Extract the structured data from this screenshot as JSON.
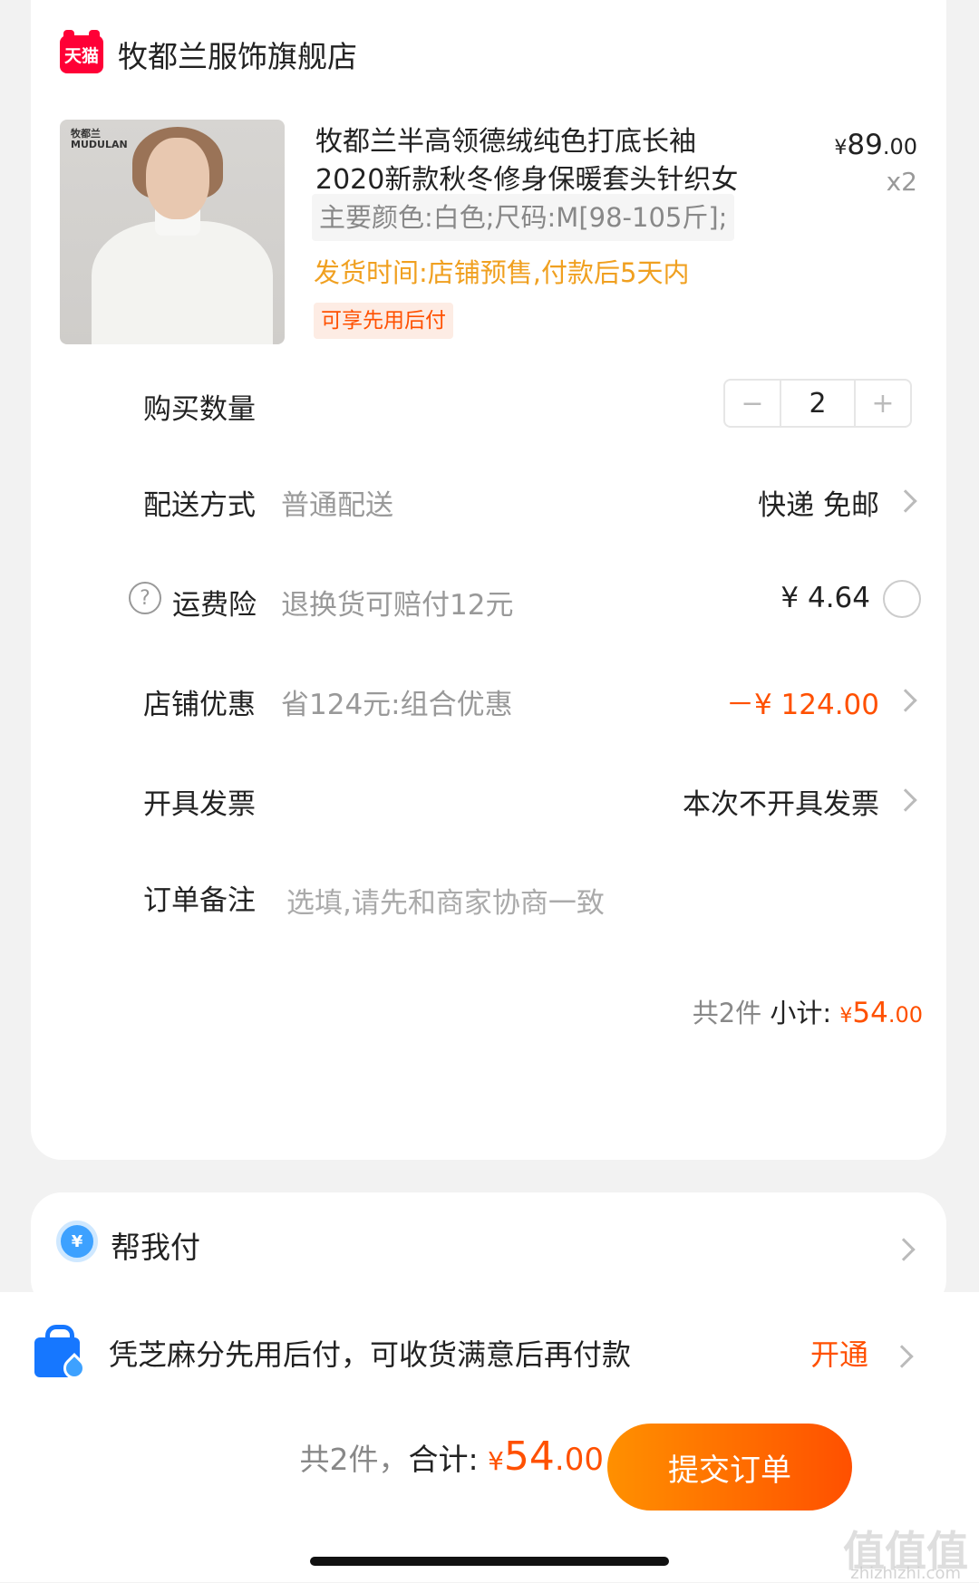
{
  "shop": {
    "badge": "天猫",
    "name": "牧都兰服饰旗舰店"
  },
  "product": {
    "brand_mark": "牧都兰\nMUDULAN",
    "title": "牧都兰半高领德绒纯色打底长袖2020新款秋冬修身保暖套头针织女",
    "price_symbol": "¥",
    "price_int": "89",
    "price_dec": ".00",
    "quantity": "x2",
    "sku": "主要颜色:白色;尺码:M[98-105斤];",
    "ship_time": "发货时间:店铺预售,付款后5天内",
    "tag": "可享先用后付"
  },
  "purchase_qty": {
    "label": "购买数量",
    "minus": "−",
    "value": "2",
    "plus": "+"
  },
  "delivery": {
    "label": "配送方式",
    "sub": "普通配送",
    "value": "快递 免邮"
  },
  "shipping_insurance": {
    "label": "运费险",
    "help": "?",
    "sub": "退换货可赔付12元",
    "value": "¥ 4.64"
  },
  "shop_discount": {
    "label": "店铺优惠",
    "sub": "省124元:组合优惠",
    "value": "－¥ 124.00",
    "value_color": "#ff5000"
  },
  "invoice": {
    "label": "开具发票",
    "value": "本次不开具发票"
  },
  "remark": {
    "label": "订单备注",
    "placeholder": "选填,请先和商家协商一致",
    "value": ""
  },
  "subtotal": {
    "count": "共2件",
    "label": " 小计: ",
    "symbol": "¥",
    "int": "54",
    "dec": ".00"
  },
  "help_pay": {
    "icon": "¥",
    "label": "帮我付"
  },
  "banner": {
    "text": "凭芝麻分先用后付，可收货满意后再付款",
    "action": "开通"
  },
  "total": {
    "count": "共2件，",
    "label": "合计: ",
    "symbol": "¥",
    "int": "54",
    "dec": ".00"
  },
  "submit": {
    "label": "提交订单"
  },
  "watermark": {
    "main": "值值值",
    "sub": "zhizhizhi.com"
  },
  "colors": {
    "accent": "#ff5000",
    "gold": "#f0a020",
    "tmall": "#ff0036",
    "alipay": "#1677ff"
  }
}
